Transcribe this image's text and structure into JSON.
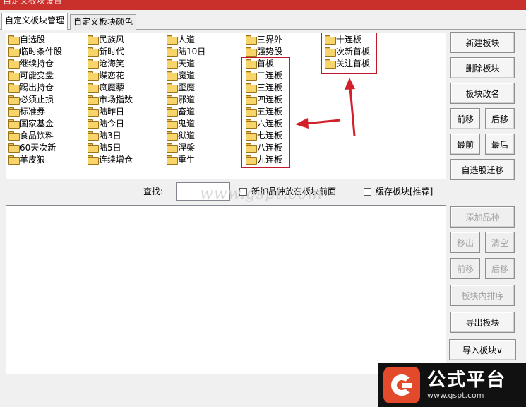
{
  "window": {
    "title": "自定义板块设置"
  },
  "tabs": [
    {
      "label": "自定义板块管理",
      "active": true
    },
    {
      "label": "自定义板块颜色",
      "active": false
    }
  ],
  "blocks": {
    "col1": [
      "自选股",
      "临时条件股",
      "继续持仓",
      "可能变盘",
      "踢出持仓",
      "必须止损",
      "标准券",
      "国家基金",
      "食品饮料",
      "60天次新",
      "羊皮狼"
    ],
    "col2": [
      "民族风",
      "新时代",
      "沧海笑",
      "蝶恋花",
      "疯魔藜",
      "市场指数",
      "陆昨日",
      "陆今日",
      "陆3日",
      "陆5日",
      "连续增仓"
    ],
    "col3": [
      "人道",
      "陆10日",
      "天道",
      "魔道",
      "歪魔",
      "邪道",
      "畜道",
      "鬼道",
      "狱道",
      "涅槃",
      "重生"
    ],
    "col4": [
      "三界外",
      "强势股",
      "首板",
      "二连板",
      "三连板",
      "四连板",
      "五连板",
      "六连板",
      "七连板",
      "八连板",
      "九连板"
    ],
    "col5": [
      "十连板",
      "次新首板",
      "关注首板"
    ]
  },
  "right_buttons": {
    "new_block": "新建板块",
    "delete_block": "删除板块",
    "rename_block": "板块改名",
    "move_forward": "前移",
    "move_backward": "后移",
    "move_first": "最前",
    "move_last": "最后",
    "migrate_watchlist": "自选股迁移"
  },
  "search": {
    "label": "查找:",
    "value": ""
  },
  "options": {
    "new_stock_front": "新加品种放在板块前面",
    "cache_block": "缓存板块[推荐]"
  },
  "bottom_buttons": {
    "add_stock": "添加品种",
    "remove": "移出",
    "clear": "清空",
    "move_forward": "前移",
    "move_backward": "后移",
    "sort_in_block": "板块内排序",
    "export_block": "导出板块",
    "import_block": "导入板块∨"
  },
  "watermark": "www.gspt.com",
  "logo": {
    "name": "公式平台",
    "url": "www.gspt.com"
  },
  "colors": {
    "highlight": "#c3172c",
    "folder": "#f7d56b",
    "logo_red": "#e24a2b"
  }
}
